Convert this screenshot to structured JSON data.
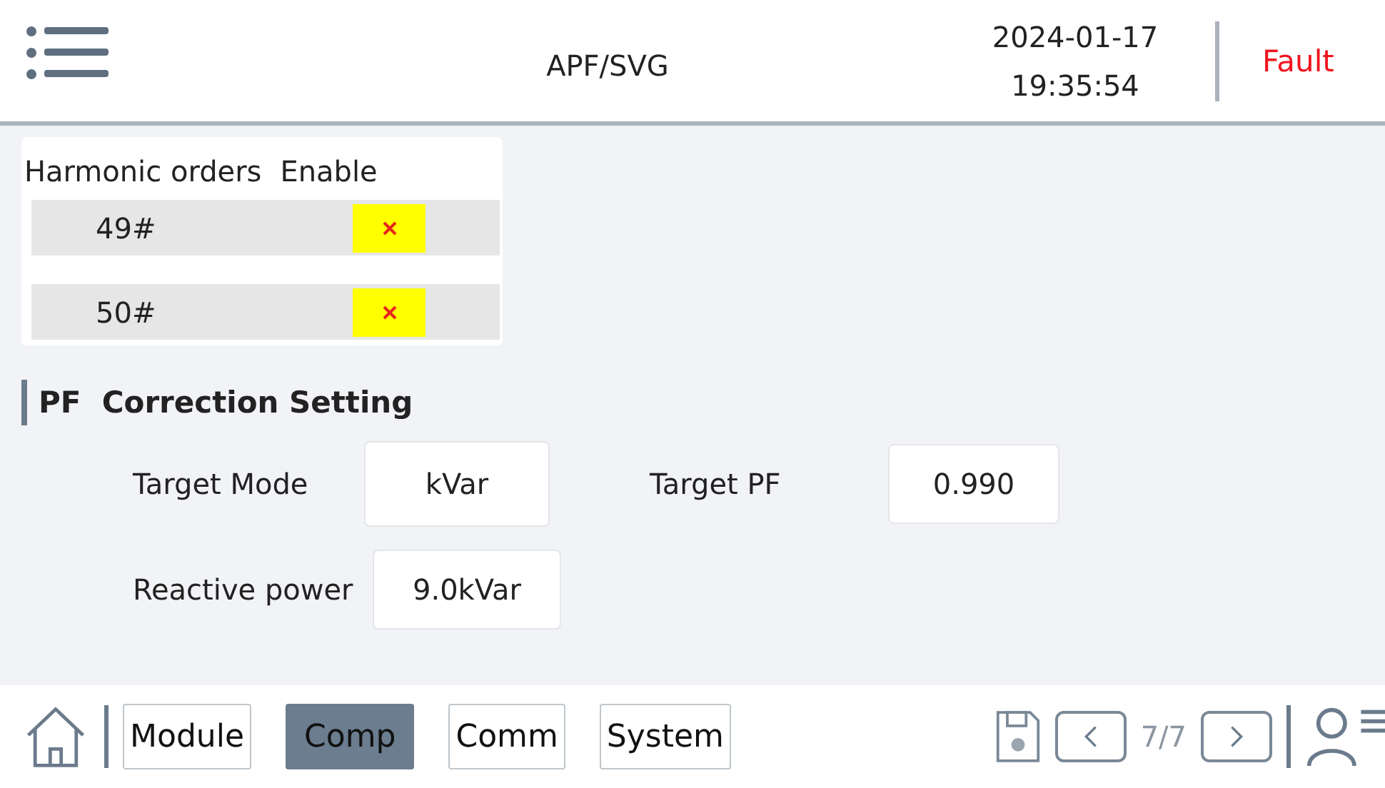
{
  "header": {
    "title": "APF/SVG",
    "date": "2024-01-17",
    "time": "19:35:54",
    "status": "Fault"
  },
  "harmonics": {
    "columns": [
      "Harmonic orders",
      "Enable"
    ],
    "rows": [
      {
        "order": "49#",
        "enabled": false
      },
      {
        "order": "50#",
        "enabled": false
      }
    ]
  },
  "pf_section": {
    "title": "PF  Correction Setting",
    "fields": [
      {
        "label": "Target Mode",
        "value": "kVar"
      },
      {
        "label": "Target PF",
        "value": "0.990"
      },
      {
        "label": "Reactive power",
        "value": "9.0kVar"
      }
    ]
  },
  "nav": {
    "tabs": [
      {
        "label": "Module",
        "selected": false
      },
      {
        "label": "Comp",
        "selected": true
      },
      {
        "label": "Comm",
        "selected": false
      },
      {
        "label": "System",
        "selected": false
      }
    ],
    "page": "7/7"
  }
}
